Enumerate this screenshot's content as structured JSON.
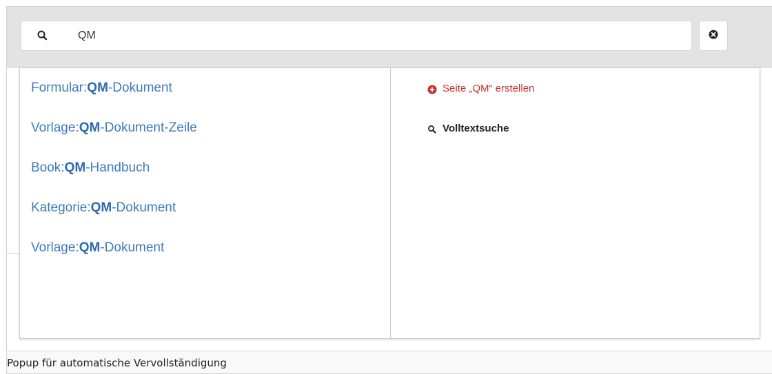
{
  "search": {
    "value": "QM",
    "icon": "search-icon",
    "clear_icon": "close-circle-icon"
  },
  "suggestions": [
    {
      "prefix": "Formular:",
      "match": "QM",
      "suffix": "-Dokument"
    },
    {
      "prefix": "Vorlage:",
      "match": "QM",
      "suffix": "-Dokument-Zeile"
    },
    {
      "prefix": "Book:",
      "match": "QM",
      "suffix": "-Handbuch"
    },
    {
      "prefix": "Kategorie:",
      "match": "QM",
      "suffix": "-Dokument"
    },
    {
      "prefix": "Vorlage:",
      "match": "QM",
      "suffix": "-Dokument"
    }
  ],
  "actions": {
    "create_label": "Seite „QM“ erstellen",
    "create_icon": "plus-circle-icon",
    "fulltext_label": "Volltextsuche",
    "fulltext_icon": "search-icon"
  },
  "caption": "Popup für automatische Vervollständigung",
  "colors": {
    "link": "#3e7bbd",
    "create": "#c9302c",
    "searchbar_bg": "#e3e3e3"
  }
}
